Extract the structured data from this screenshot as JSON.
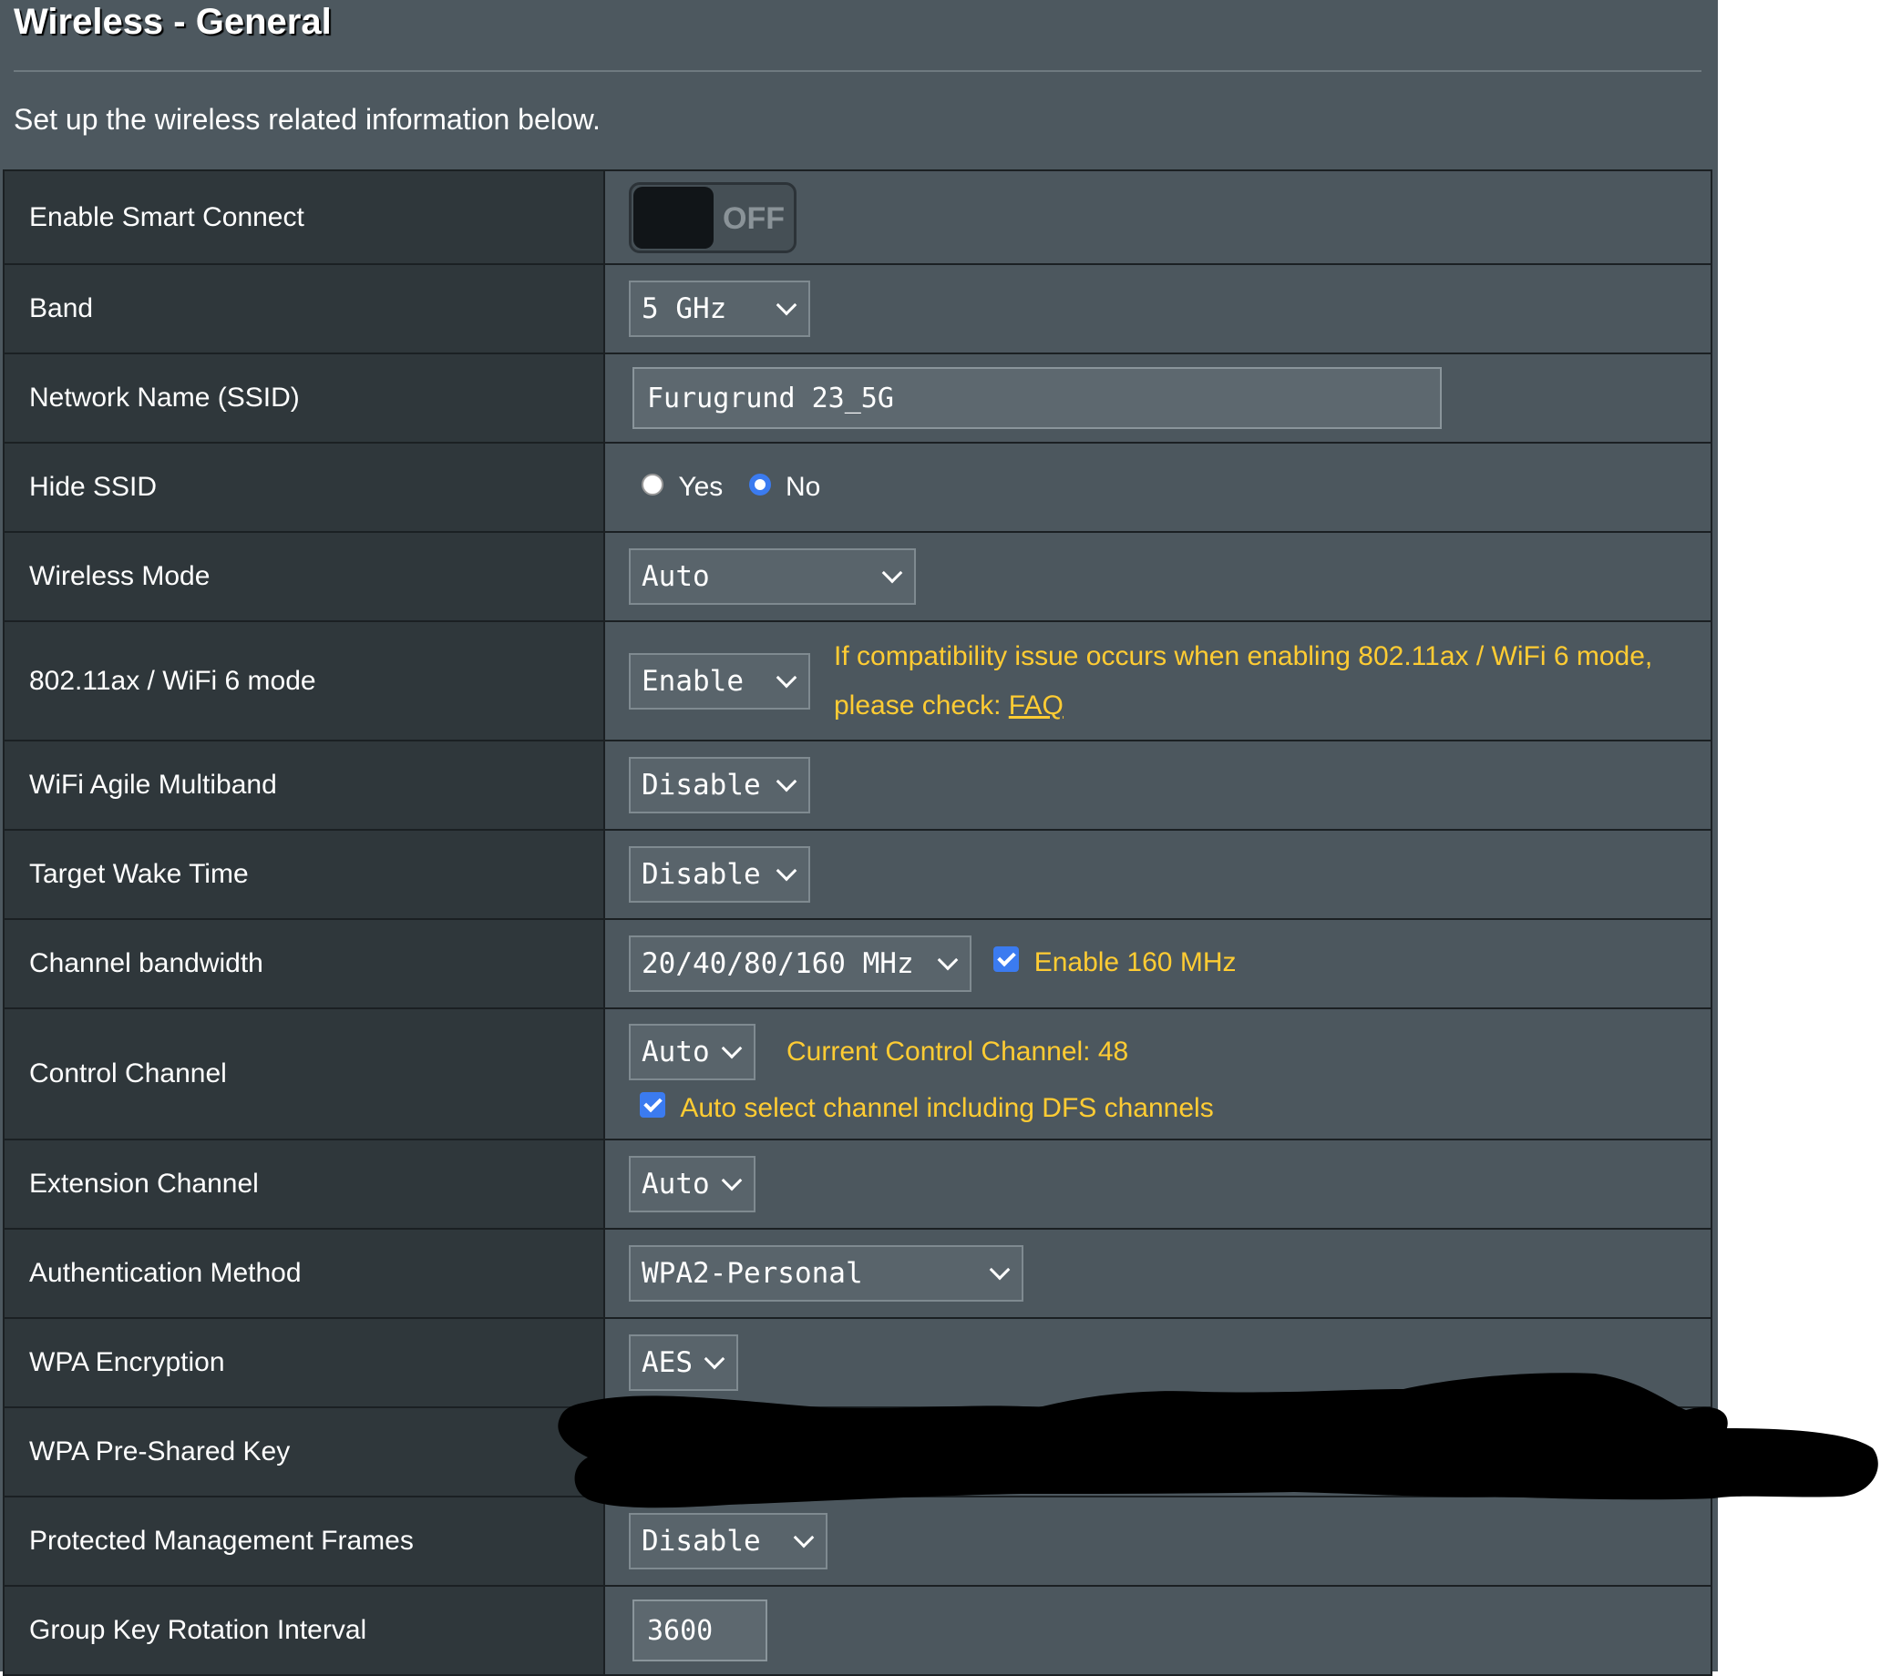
{
  "header": {
    "title": "Wireless - General",
    "description": "Set up the wireless related information below."
  },
  "rows": {
    "smart_connect": {
      "label": "Enable Smart Connect",
      "toggle_state": "OFF"
    },
    "band": {
      "label": "Band",
      "value": "5 GHz"
    },
    "ssid": {
      "label": "Network Name (SSID)",
      "value": "Furugrund 23_5G"
    },
    "hide_ssid": {
      "label": "Hide SSID",
      "option_yes": "Yes",
      "option_no": "No",
      "selected": "No"
    },
    "wireless_mode": {
      "label": "Wireless Mode",
      "value": "Auto"
    },
    "wifi6": {
      "label": "802.11ax / WiFi 6 mode",
      "value": "Enable",
      "note_line1": "If compatibility issue occurs when enabling 802.11ax / WiFi 6 mode,",
      "note_line2": "please check:",
      "faq_link": "FAQ"
    },
    "agile_multiband": {
      "label": "WiFi Agile Multiband",
      "value": "Disable"
    },
    "target_wake_time": {
      "label": "Target Wake Time",
      "value": "Disable"
    },
    "channel_bandwidth": {
      "label": "Channel bandwidth",
      "value": "20/40/80/160 MHz",
      "checkbox_label": "Enable 160 MHz",
      "checked": true
    },
    "control_channel": {
      "label": "Control Channel",
      "value": "Auto",
      "current_channel_text": "Current Control Channel: 48",
      "dfs_checkbox_label": "Auto select channel including DFS channels",
      "dfs_checked": true
    },
    "extension_channel": {
      "label": "Extension Channel",
      "value": "Auto"
    },
    "auth_method": {
      "label": "Authentication Method",
      "value": "WPA2-Personal"
    },
    "wpa_encryption": {
      "label": "WPA Encryption",
      "value": "AES"
    },
    "psk": {
      "label": "WPA Pre-Shared Key"
    },
    "pmf": {
      "label": "Protected Management Frames",
      "value": "Disable"
    },
    "group_key": {
      "label": "Group Key Rotation Interval",
      "value": "3600"
    }
  },
  "colors": {
    "panel_bg": "#4d585f",
    "label_bg": "#2f373b",
    "accent_yellow": "#ffcc33",
    "accent_blue": "#3b7bf0",
    "redaction": "#000000"
  }
}
